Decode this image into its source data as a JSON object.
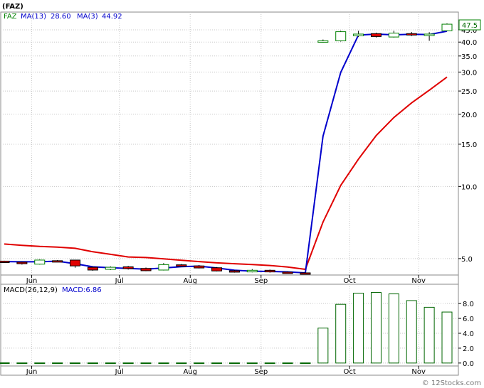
{
  "title": "(FAZ)",
  "legend": {
    "symbol": "FAZ",
    "ma_long_label": "MA(13)",
    "ma_long_value": "28.60",
    "ma_short_label": "MA(3)",
    "ma_short_value": "44.92"
  },
  "last_price_label": "47.5",
  "macd_legend": {
    "label": "MACD(26,12,9)",
    "value_label": "MACD:6.86"
  },
  "watermark": "© 12Stocks.com",
  "colors": {
    "up_candle": "#008000",
    "down_candle": "#e00000",
    "ma_long": "#e00000",
    "ma_short": "#0000cc",
    "macd_bar": "#006600",
    "grid": "#c8c8c8"
  },
  "chart_data": [
    {
      "type": "candlestick",
      "title": "(FAZ)",
      "y_scale": "log",
      "ylim": [
        4.3,
        53
      ],
      "yticks": [
        5.0,
        10.0,
        15.0,
        20.0,
        25.0,
        30.0,
        35.0,
        40.0,
        45.0
      ],
      "ytick_labels": [
        "5.0",
        "10.0",
        "15.0",
        "20.0",
        "25.0",
        "30.0",
        "35.0",
        "40.0",
        "45.0"
      ],
      "x_count": 26,
      "month_ticks": [
        {
          "label": "Jun",
          "index": 1.25
        },
        {
          "label": "Jul",
          "index": 6.2
        },
        {
          "label": "Aug",
          "index": 10.2
        },
        {
          "label": "Sep",
          "index": 14.2
        },
        {
          "label": "Oct",
          "index": 19.2
        },
        {
          "label": "Nov",
          "index": 23.1
        }
      ],
      "candles": [
        {
          "o": 4.88,
          "c": 4.84,
          "h": 4.9,
          "l": 4.8
        },
        {
          "o": 4.83,
          "c": 4.76,
          "h": 4.86,
          "l": 4.72
        },
        {
          "o": 4.74,
          "c": 4.93,
          "h": 4.96,
          "l": 4.72
        },
        {
          "o": 4.9,
          "c": 4.89,
          "h": 4.93,
          "l": 4.85
        },
        {
          "o": 4.93,
          "c": 4.66,
          "h": 4.94,
          "l": 4.58
        },
        {
          "o": 4.6,
          "c": 4.48,
          "h": 4.63,
          "l": 4.45
        },
        {
          "o": 4.51,
          "c": 4.6,
          "h": 4.64,
          "l": 4.48
        },
        {
          "o": 4.62,
          "c": 4.54,
          "h": 4.66,
          "l": 4.5
        },
        {
          "o": 4.55,
          "c": 4.45,
          "h": 4.59,
          "l": 4.43
        },
        {
          "o": 4.48,
          "c": 4.72,
          "h": 4.79,
          "l": 4.46
        },
        {
          "o": 4.71,
          "c": 4.66,
          "h": 4.75,
          "l": 4.63
        },
        {
          "o": 4.66,
          "c": 4.57,
          "h": 4.7,
          "l": 4.55
        },
        {
          "o": 4.58,
          "c": 4.44,
          "h": 4.61,
          "l": 4.42
        },
        {
          "o": 4.45,
          "c": 4.39,
          "h": 4.48,
          "l": 4.37
        },
        {
          "o": 4.4,
          "c": 4.47,
          "h": 4.52,
          "l": 4.38
        },
        {
          "o": 4.47,
          "c": 4.4,
          "h": 4.5,
          "l": 4.37
        },
        {
          "o": 4.39,
          "c": 4.36,
          "h": 4.42,
          "l": 4.34
        },
        {
          "o": 4.36,
          "c": 4.34,
          "h": 4.38,
          "l": 4.33
        },
        {
          "o": 40.0,
          "c": 40.5,
          "h": 41.0,
          "l": 39.8
        },
        {
          "o": 40.5,
          "c": 44.2,
          "h": 44.6,
          "l": 40.2
        },
        {
          "o": 42.5,
          "c": 43.2,
          "h": 44.6,
          "l": 42.0
        },
        {
          "o": 43.4,
          "c": 42.2,
          "h": 43.8,
          "l": 41.8
        },
        {
          "o": 42.0,
          "c": 43.6,
          "h": 44.6,
          "l": 41.8
        },
        {
          "o": 43.4,
          "c": 42.8,
          "h": 44.1,
          "l": 42.4
        },
        {
          "o": 42.6,
          "c": 43.2,
          "h": 44.0,
          "l": 40.5
        },
        {
          "o": 44.6,
          "c": 47.5,
          "h": 47.9,
          "l": 44.4
        }
      ],
      "ma_short": [
        4.86,
        4.85,
        4.85,
        4.88,
        4.76,
        4.62,
        4.58,
        4.55,
        4.52,
        4.57,
        4.63,
        4.65,
        4.57,
        4.47,
        4.43,
        4.42,
        4.4,
        4.36,
        16.2,
        29.9,
        42.8,
        43.2,
        42.9,
        43.1,
        43.0,
        44.4
      ],
      "ma_long": [
        5.75,
        5.68,
        5.62,
        5.58,
        5.52,
        5.34,
        5.21,
        5.08,
        5.05,
        4.99,
        4.92,
        4.86,
        4.8,
        4.76,
        4.72,
        4.68,
        4.61,
        4.51,
        7.1,
        10.1,
        13.0,
        16.3,
        19.4,
        22.3,
        25.2,
        28.6
      ],
      "series": [
        {
          "name": "MA(13)",
          "values_ref": "ma_long"
        },
        {
          "name": "MA(3)",
          "values_ref": "ma_short"
        }
      ]
    },
    {
      "type": "bar",
      "title": "MACD(26,12,9)",
      "ylim": [
        -0.3,
        10.5
      ],
      "yticks": [
        0.0,
        2.0,
        4.0,
        6.0,
        8.0
      ],
      "ytick_labels": [
        "0.0",
        "2.0",
        "4.0",
        "6.0",
        "8.0"
      ],
      "values": [
        0.03,
        0.02,
        0.02,
        0.02,
        0.02,
        0.02,
        0.02,
        0.02,
        0.02,
        0.02,
        0.02,
        0.02,
        0.02,
        0.02,
        0.02,
        0.02,
        0.02,
        0.02,
        4.7,
        7.9,
        9.4,
        9.5,
        9.3,
        8.4,
        7.5,
        6.86
      ],
      "month_ticks": [
        {
          "label": "Jun",
          "index": 1.25
        },
        {
          "label": "Jul",
          "index": 6.2
        },
        {
          "label": "Aug",
          "index": 10.2
        },
        {
          "label": "Sep",
          "index": 14.2
        },
        {
          "label": "Oct",
          "index": 19.2
        },
        {
          "label": "Nov",
          "index": 23.1
        }
      ]
    }
  ]
}
